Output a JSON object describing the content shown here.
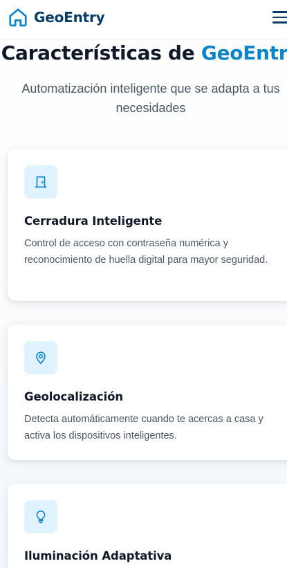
{
  "nav": {
    "brand": "GeoEntry",
    "logo_icon": "home-icon",
    "menu_icon": "hamburger-menu-icon"
  },
  "features": {
    "title_prefix": "Características de",
    "title_accent": "GeoEntry",
    "subtitle": "Automatización inteligente que se adapta a tus necesidades",
    "cards": [
      {
        "icon": "door-icon",
        "title": "Cerradura Inteligente",
        "text": "Control de acceso con contraseña numérica y reconocimiento de huella digital para mayor seguridad."
      },
      {
        "icon": "location-pin-icon",
        "title": "Geolocalización",
        "text": "Detecta automáticamente cuando te acercas a casa y activa los dispositivos inteligentes."
      },
      {
        "icon": "lightbulb-icon",
        "title": "Iluminación Adaptativa",
        "text": ""
      }
    ]
  },
  "colors": {
    "brand_dark": "#0a3d66",
    "accent_blue": "#0d83c8",
    "icon_bg": "#e0f2fe",
    "heading": "#111827",
    "body_text": "#4b5563"
  }
}
